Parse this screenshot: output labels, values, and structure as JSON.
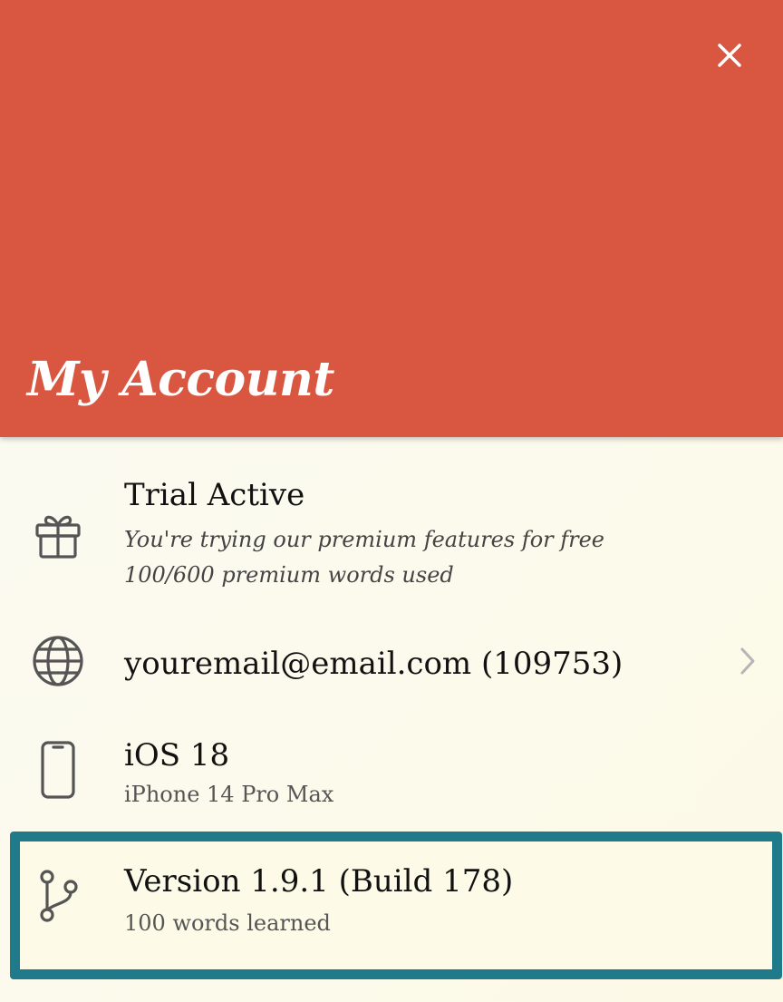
{
  "header": {
    "title": "My Account",
    "close_icon": "close-icon",
    "background_color": "#d95741"
  },
  "rows": {
    "trial": {
      "icon": "gift-icon",
      "title": "Trial Active",
      "subtitle": "You're trying our premium features for free",
      "usage": "100/600 premium words used"
    },
    "account": {
      "icon": "globe-icon",
      "title": "youremail@email.com (109753)",
      "chevron_icon": "chevron-right-icon"
    },
    "device": {
      "icon": "phone-icon",
      "title": "iOS 18",
      "subtitle": "iPhone 14 Pro Max"
    },
    "version": {
      "icon": "git-branch-icon",
      "title": "Version 1.9.1 (Build 178)",
      "subtitle": "100 words learned",
      "highlight_color": "#1f7a8a"
    }
  }
}
